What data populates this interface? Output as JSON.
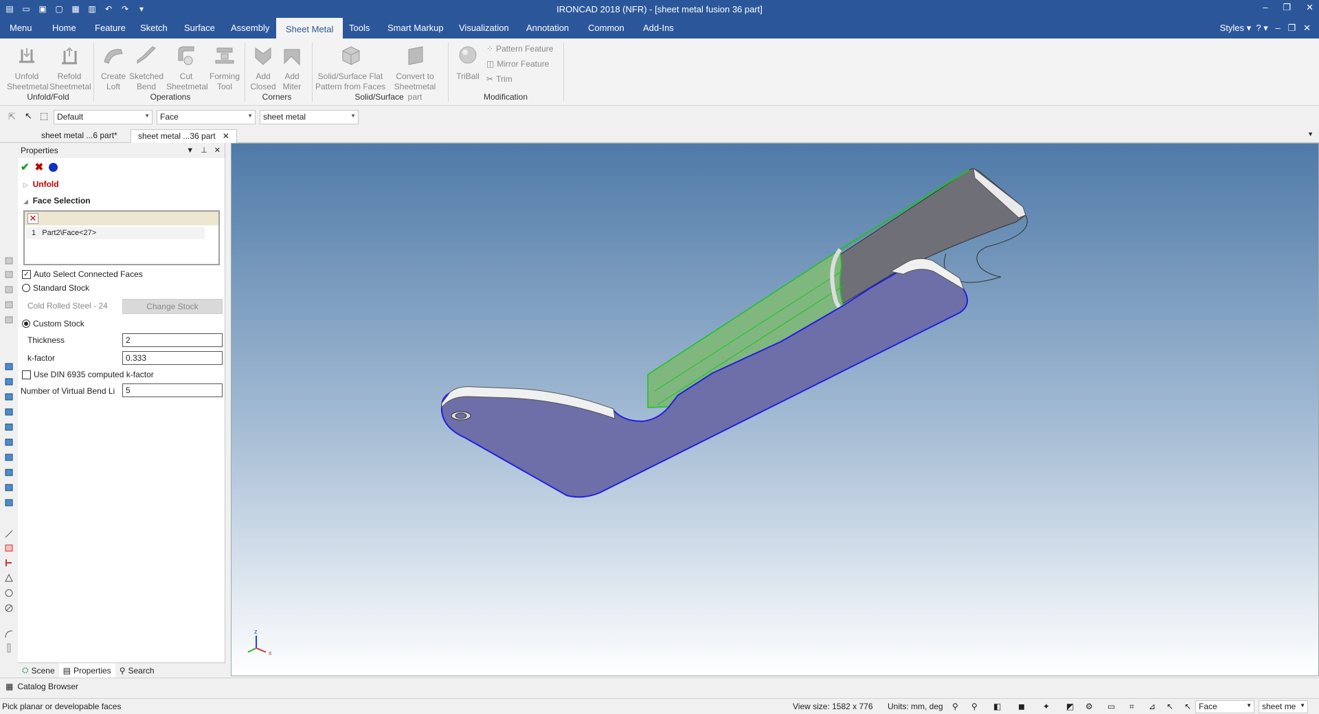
{
  "app": {
    "title": "IRONCAD 2018 (NFR) - [sheet metal fusion 36 part]"
  },
  "menu": {
    "tabs": [
      "Menu",
      "Home",
      "Feature",
      "Sketch",
      "Surface",
      "Assembly",
      "Sheet Metal",
      "Tools",
      "Smart Markup",
      "Visualization",
      "Annotation",
      "Common",
      "Add-Ins"
    ],
    "active": "Sheet Metal",
    "styles_label": "Styles"
  },
  "ribbon": {
    "unfold_fold": {
      "label": "Unfold/Fold",
      "unfold": [
        "Unfold",
        "Sheetmetal"
      ],
      "refold": [
        "Refold",
        "Sheetmetal"
      ]
    },
    "operations": {
      "label": "Operations",
      "create_loft": [
        "Create",
        "Loft"
      ],
      "sketched_bend": [
        "Sketched",
        "Bend"
      ],
      "cut_sheetmetal": [
        "Cut",
        "Sheetmetal"
      ],
      "forming_tool": [
        "Forming",
        "Tool"
      ]
    },
    "corners": {
      "label": "Corners",
      "add_closed": [
        "Add",
        "Closed"
      ],
      "add_miter": [
        "Add",
        "Miter"
      ]
    },
    "solid_surface": {
      "label": "Solid/Surface",
      "flat_pattern": [
        "Solid/Surface Flat",
        "Pattern from Faces"
      ],
      "convert": [
        "Convert to",
        "Sheetmetal part"
      ]
    },
    "modification": {
      "label": "Modification",
      "triball": "TriBall",
      "pattern_feature": "Pattern Feature",
      "mirror_feature": "Mirror Feature",
      "trim": "Trim"
    }
  },
  "toolbar": {
    "style_combo": "Default",
    "selection_combo": "Face",
    "scope_combo": "sheet metal"
  },
  "doc_tabs": [
    "sheet metal ...6 part*",
    "sheet metal ...36 part"
  ],
  "properties": {
    "title": "Properties",
    "section_unfold": "Unfold",
    "section_face_selection": "Face Selection",
    "selection_rows": [
      {
        "index": "1",
        "name": "Part2\\Face<27>"
      }
    ],
    "auto_select_label": "Auto Select Connected Faces",
    "auto_select_checked": true,
    "standard_stock_label": "Standard Stock",
    "stock_material": "Cold Rolled Steel - 24",
    "change_stock_label": "Change Stock",
    "custom_stock_label": "Custom Stock",
    "thickness_label": "Thickness",
    "thickness_value": "2",
    "kfactor_label": "k-factor",
    "kfactor_value": "0.333",
    "din_label": "Use DIN 6935 computed k-factor",
    "din_checked": false,
    "virtual_bend_label": "Number of Virtual Bend Li",
    "virtual_bend_value": "5"
  },
  "panel_tabs": [
    "Scene",
    "Properties",
    "Search"
  ],
  "catalog_label": "Catalog Browser",
  "status": {
    "prompt": "Pick planar or developable faces",
    "view_size": "View size: 1582 x  776",
    "units": "Units: mm, deg",
    "select_combo": "Face",
    "scope_combo": "sheet me"
  },
  "axes": {
    "x": "x",
    "z": "z"
  },
  "colors": {
    "title_bar": "#2b579a",
    "selected_face": "#6e6ea8",
    "bend_face": "#7fb77f",
    "face_edge": "#2020e0",
    "panel_accent_red": "#c00000"
  }
}
